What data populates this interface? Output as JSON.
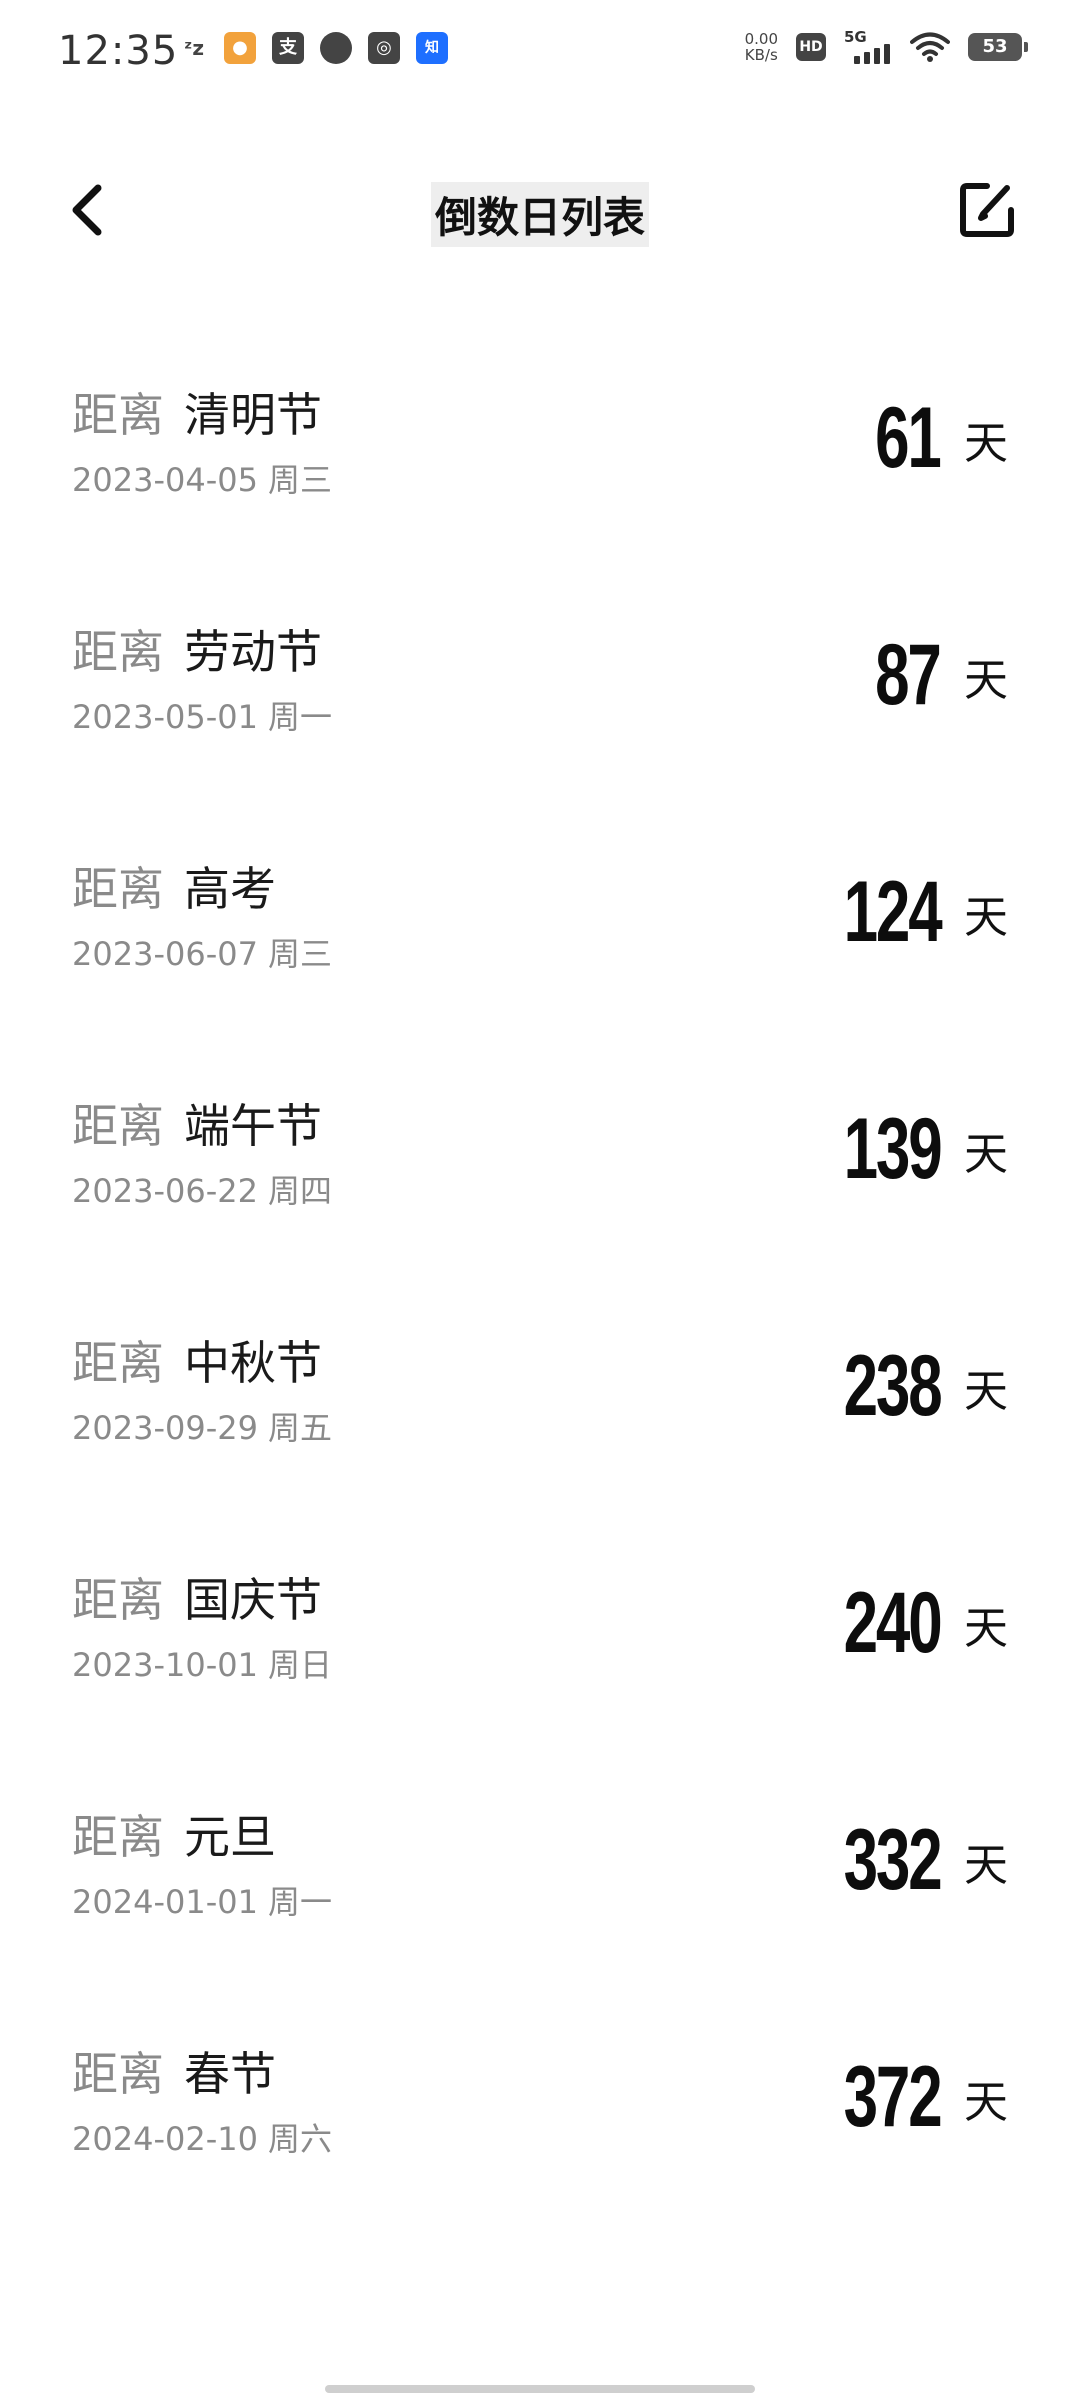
{
  "status_bar": {
    "time": "12:35",
    "net_speed_value": "0.00",
    "net_speed_unit": "KB/s",
    "hd_label": "HD",
    "network_label": "5G",
    "battery": "53"
  },
  "header": {
    "title": "倒数日列表"
  },
  "countdowns": [
    {
      "prefix": "距离",
      "name": "清明节",
      "date": "2023-04-05",
      "weekday": "周三",
      "days": "61",
      "unit": "天"
    },
    {
      "prefix": "距离",
      "name": "劳动节",
      "date": "2023-05-01",
      "weekday": "周一",
      "days": "87",
      "unit": "天"
    },
    {
      "prefix": "距离",
      "name": "高考",
      "date": "2023-06-07",
      "weekday": "周三",
      "days": "124",
      "unit": "天"
    },
    {
      "prefix": "距离",
      "name": "端午节",
      "date": "2023-06-22",
      "weekday": "周四",
      "days": "139",
      "unit": "天"
    },
    {
      "prefix": "距离",
      "name": "中秋节",
      "date": "2023-09-29",
      "weekday": "周五",
      "days": "238",
      "unit": "天"
    },
    {
      "prefix": "距离",
      "name": "国庆节",
      "date": "2023-10-01",
      "weekday": "周日",
      "days": "240",
      "unit": "天"
    },
    {
      "prefix": "距离",
      "name": "元旦",
      "date": "2024-01-01",
      "weekday": "周一",
      "days": "332",
      "unit": "天"
    },
    {
      "prefix": "距离",
      "name": "春节",
      "date": "2024-02-10",
      "weekday": "周六",
      "days": "372",
      "unit": "天"
    }
  ],
  "icons": {
    "back": "chevron-left-icon",
    "edit": "edit-icon"
  }
}
